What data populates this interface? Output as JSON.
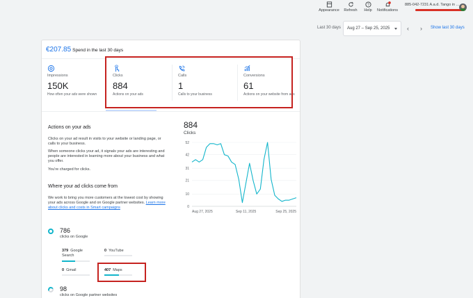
{
  "topbar": {
    "appearance": "Appearance",
    "refresh": "Refresh",
    "help": "Help",
    "notifications": "Notifications",
    "account": "885-042-7231 A.a.d. Tango in ..."
  },
  "daterange": {
    "label": "Last 30 days",
    "value": "Aug 27 – Sep 25, 2025",
    "prev": "‹",
    "next": "›",
    "show_last": "Show last 30 days"
  },
  "summary": {
    "spend_amount": "€207.85",
    "spend_text": "Spend in the last 30 days"
  },
  "metrics": [
    {
      "label": "Impressions",
      "value": "150K",
      "desc": "How often your ads were shown"
    },
    {
      "label": "Clicks",
      "value": "884",
      "desc": "Actions on your ads"
    },
    {
      "label": "Calls",
      "value": "1",
      "desc": "Calls to your business"
    },
    {
      "label": "Conversions",
      "value": "61",
      "desc": "Actions on your website from ads"
    }
  ],
  "actions": {
    "heading": "Actions on your ads",
    "p1": "Clicks on your ad result in visits to your website or landing page, or calls to your business.",
    "p2": "When someone clicks your ad, it signals your ads are interesting and people are interested in learning more about your business and what you offer.",
    "p3": "You're charged for clicks."
  },
  "where": {
    "heading": "Where your ad clicks come from",
    "p1": "We work to bring you more customers at the lowest cost by showing your ads across Google and on Google partner websites.",
    "link": "Learn more about clicks and costs in Smart campaigns"
  },
  "google": {
    "total": "786",
    "label": "clicks on Google",
    "tiles": [
      {
        "num": "379",
        "name": "Google Search",
        "fraction": 0.48
      },
      {
        "num": "0",
        "name": "YouTube",
        "fraction": 0
      },
      {
        "num": "0",
        "name": "Gmail",
        "fraction": 0
      },
      {
        "num": "407",
        "name": "Maps",
        "fraction": 0.52
      }
    ]
  },
  "partners": {
    "total": "98",
    "label": "clicks on Google partner websites"
  },
  "chart": {
    "value": "884",
    "label": "Clicks"
  },
  "chart_data": {
    "type": "line",
    "title": "Clicks",
    "xlabel": "",
    "ylabel": "",
    "ylim": [
      0,
      52
    ],
    "y_ticks": [
      0,
      10,
      21,
      31,
      42,
      52
    ],
    "x_ticks": [
      "Aug 27, 2025",
      "Sep 11, 2025",
      "Sep 25, 2025"
    ],
    "grid": true,
    "color": "#12b5cb",
    "series": [
      {
        "x": [
          "2025-08-27",
          "2025-08-28",
          "2025-08-29",
          "2025-08-30",
          "2025-08-31",
          "2025-09-01",
          "2025-09-02",
          "2025-09-03",
          "2025-09-04",
          "2025-09-05",
          "2025-09-06",
          "2025-09-07",
          "2025-09-08",
          "2025-09-09",
          "2025-09-10",
          "2025-09-11",
          "2025-09-12",
          "2025-09-13",
          "2025-09-14",
          "2025-09-15",
          "2025-09-16",
          "2025-09-17",
          "2025-09-18",
          "2025-09-19",
          "2025-09-20",
          "2025-09-21",
          "2025-09-22",
          "2025-09-23",
          "2025-09-24",
          "2025-09-25"
        ],
        "values": [
          36,
          38,
          36,
          38,
          48,
          51,
          51,
          50,
          51,
          42,
          41,
          36,
          34,
          22,
          3,
          19,
          35,
          21,
          10,
          14,
          38,
          52,
          22,
          9,
          6,
          4,
          5,
          5,
          6,
          7
        ]
      }
    ]
  }
}
